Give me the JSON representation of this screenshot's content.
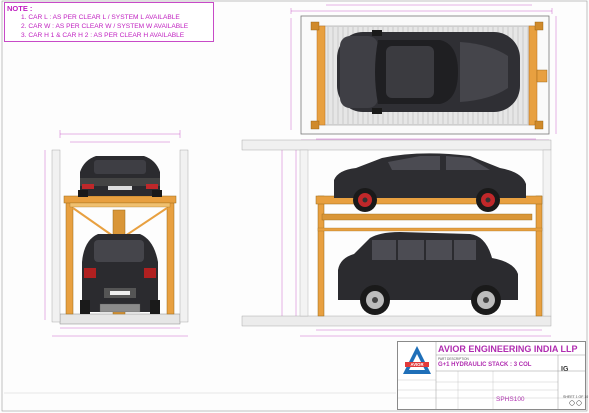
{
  "note": {
    "title": "NOTE :",
    "lines": [
      "1. CAR L : AS PER CLEAR L / SYSTEM L AVAILABLE",
      "2. CAR W : AS PER CLEAR W / SYSTEM W AVAILABLE",
      "3. CAR H 1 & CAR H 2 : AS PER CLEAR H AVAILABLE"
    ]
  },
  "title_block": {
    "company": "AVIOR ENGINEERING INDIA LLP",
    "logo_text": "AVIOR",
    "part_description_label": "PART DESCRIPTION",
    "part_description": "G+1 HYDRAULIC STACK : 3 COL",
    "drawing_no": "SPHS100",
    "rev": "IG",
    "sheet": "SHEET\n1 OF 10"
  },
  "colors": {
    "frame_orange": "#e8a040",
    "frame_dark": "#c47a1e",
    "platform_grey": "#d9d9d9",
    "car_dark": "#2b2b2f",
    "wheel_red": "#c0282a",
    "dimension_magenta": "#c040c0",
    "accent_purple": "#b02cb0"
  }
}
